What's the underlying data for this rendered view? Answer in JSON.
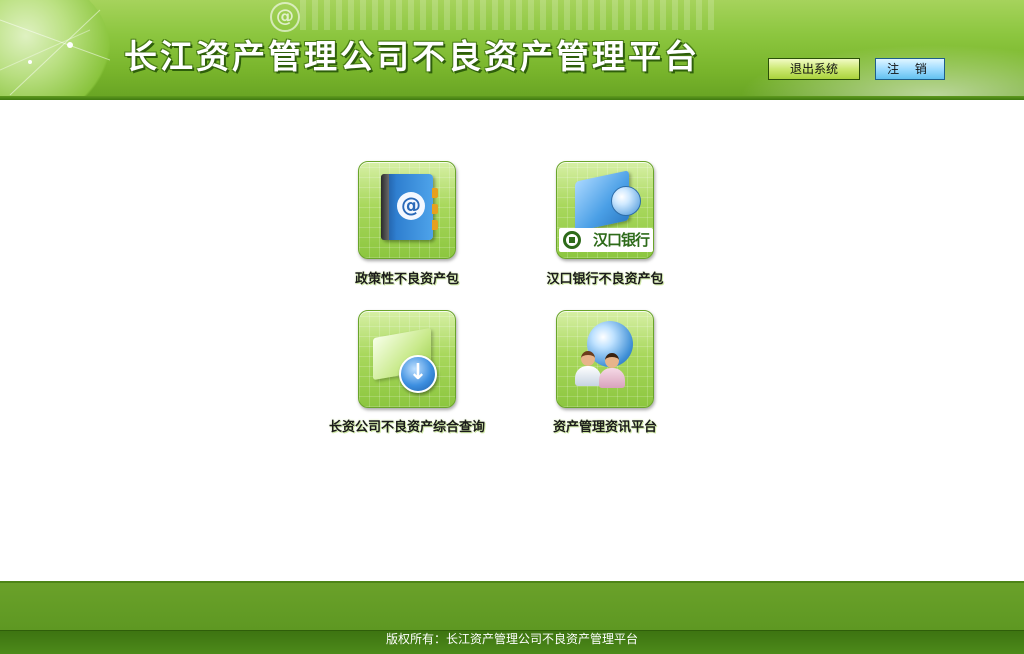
{
  "header": {
    "title": "长江资产管理公司不良资产管理平台",
    "exit_label": "退出系统",
    "logout_label": "注 销"
  },
  "tiles": [
    {
      "label": "政策性不良资产包",
      "icon": "address-book-icon"
    },
    {
      "label": "汉口银行不良资产包",
      "icon": "hankou-bank-icon",
      "logo_text": "汉口银行"
    },
    {
      "label": "长资公司不良资产综合查询",
      "icon": "download-icon"
    },
    {
      "label": "资产管理资讯平台",
      "icon": "users-globe-icon"
    }
  ],
  "footer": {
    "copyright": "版权所有：长江资产管理公司不良资产管理平台"
  },
  "colors": {
    "header_green": "#8cc63f",
    "footer_green": "#5e9822",
    "exit_button": "#cbe872",
    "logout_button": "#9fdcff"
  }
}
